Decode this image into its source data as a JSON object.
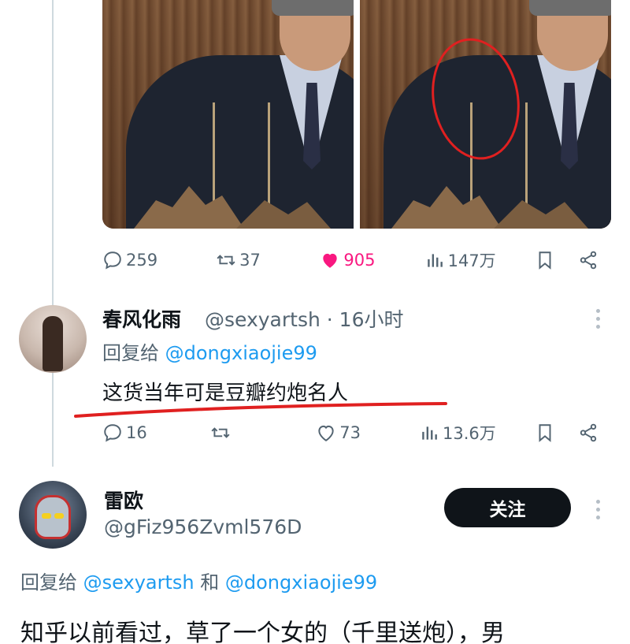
{
  "thread": {
    "tweet1": {
      "actions": {
        "replies": "259",
        "retweets": "37",
        "likes": "905",
        "views": "147万"
      }
    },
    "reply1": {
      "name": "春风化雨",
      "handle_meta": "@sexyartsh · 16小时",
      "reply_label": "回复给",
      "reply_mention": "@dongxiaojie99",
      "text": "这货当年可是豆瓣约炮名人",
      "actions": {
        "replies": "16",
        "retweets": "",
        "likes": "73",
        "views": "13.6万"
      }
    },
    "reply2": {
      "name": "雷欧",
      "handle": "@gFiz956Zvml576D",
      "follow_label": "关注",
      "reply_label": "回复给",
      "reply_mention_1": "@sexyartsh",
      "reply_and": "和",
      "reply_mention_2": "@dongxiaojie99",
      "text": "知乎以前看过，草了一个女的（千里送炮），男"
    }
  },
  "colors": {
    "like": "#f91880",
    "mention": "#1d9bf0",
    "annotation": "#e02020"
  },
  "icons": [
    "reply-icon",
    "retweet-icon",
    "heart-icon",
    "views-icon",
    "bookmark-icon",
    "share-icon",
    "more-icon"
  ]
}
